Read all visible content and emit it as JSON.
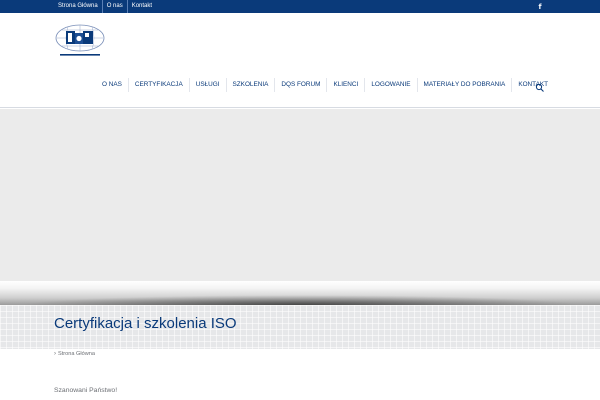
{
  "topbar": {
    "links": [
      "Strona Główna",
      "O nas",
      "Kontakt"
    ],
    "social_icon": "facebook-icon"
  },
  "header": {
    "logo_icon": "dqs-logo-icon",
    "nav": [
      "O NAS",
      "CERTYFIKACJA",
      "USŁUGI",
      "SZKOLENIA",
      "DQS FORUM",
      "KLIENCI",
      "LOGOWANIE",
      "MATERIAŁY DO POBRANIA",
      "KONTAKT"
    ],
    "search_icon": "search-icon"
  },
  "page": {
    "title": "Certyfikacja i szkolenia ISO",
    "breadcrumb": "Strona Główna",
    "intro": "Szanowani Państwo!"
  },
  "colors": {
    "brand_blue": "#0a3a7a",
    "hero_gray": "#ebebeb",
    "text_gray": "#6c6f74"
  }
}
